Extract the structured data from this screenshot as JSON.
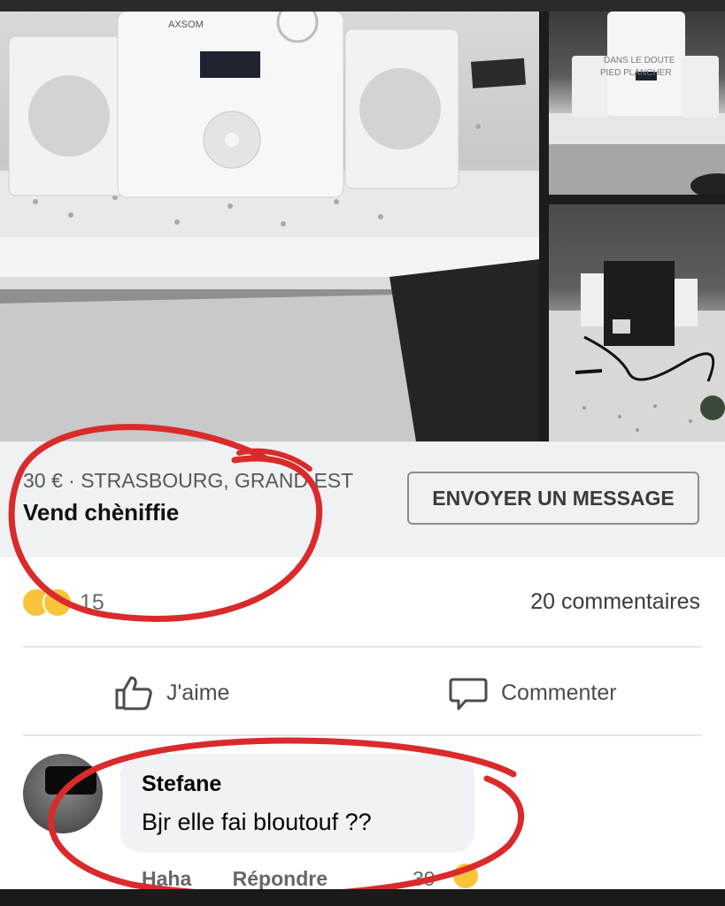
{
  "photos": {
    "main_brand": "AXSOM",
    "watermark_line1": "DANS LE DOUTE",
    "watermark_line2": "PIED PLANCHER"
  },
  "listing": {
    "price_location": "30 € · STRASBOURG, GRAND EST",
    "title": "Vend chèniffie",
    "message_button": "ENVOYER UN MESSAGE"
  },
  "post": {
    "reaction_count": "15",
    "comments_count": "20 commentaires",
    "like_label": "J'aime",
    "comment_label": "Commenter"
  },
  "comment": {
    "author": "Stefane",
    "text": "Bjr elle fai bloutouf ??",
    "haha_label": "Haha",
    "reply_label": "Répondre",
    "reaction_count": "39"
  },
  "colors": {
    "circle": "#d92b2b",
    "emoji": "#f7c43a"
  }
}
